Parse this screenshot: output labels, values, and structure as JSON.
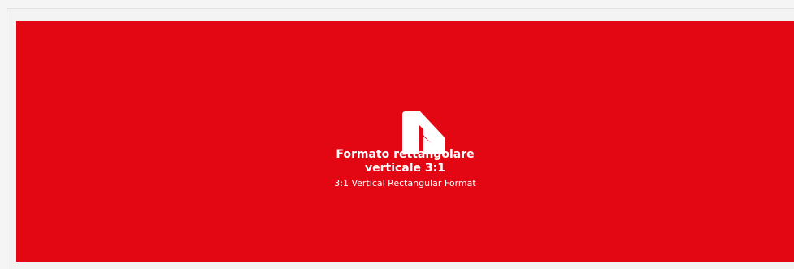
{
  "banner": {
    "title_line1": "Formato rettangolare",
    "title_line2": "verticale 3:1",
    "subtitle": "3:1 Vertical Rectangular Format",
    "logo_icon": "brand-logo-icon",
    "background_color": "#e30613",
    "text_color": "#ffffff"
  }
}
